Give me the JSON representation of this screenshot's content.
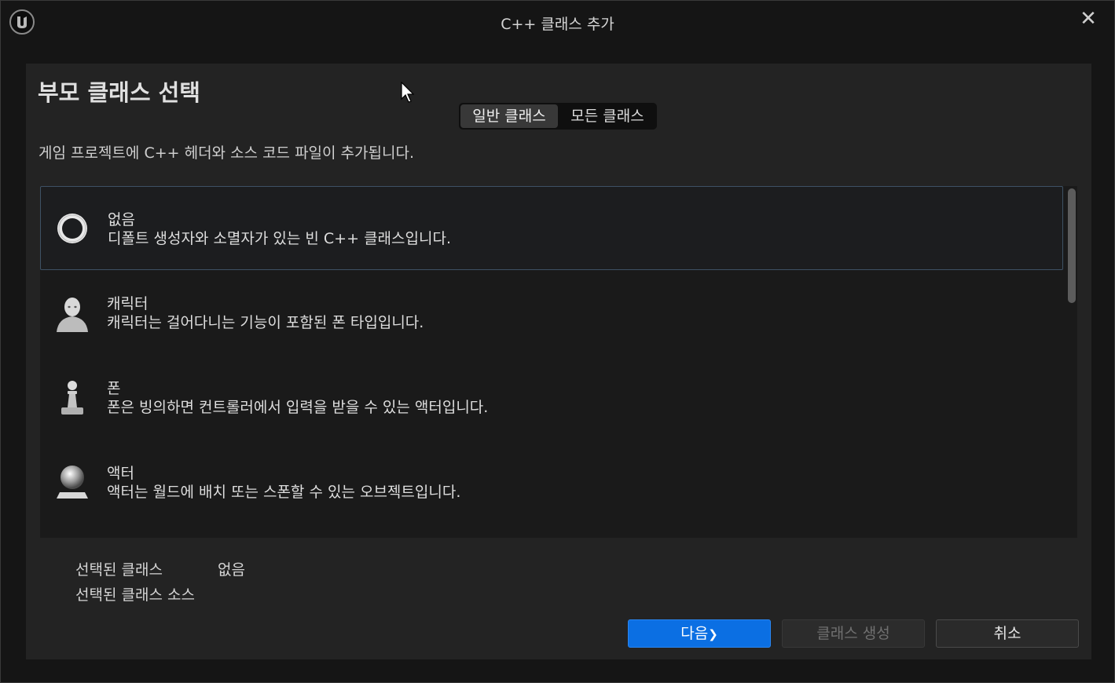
{
  "window": {
    "title": "C++ 클래스 추가",
    "close_glyph": "✕"
  },
  "header": {
    "title": "부모 클래스 선택",
    "description": "게임 프로젝트에 C++ 헤더와 소스 코드 파일이 추가됩니다."
  },
  "tabs": [
    {
      "label": "일반 클래스",
      "active": true
    },
    {
      "label": "모든 클래스",
      "active": false
    }
  ],
  "class_list": [
    {
      "name": "없음",
      "description": "디폴트 생성자와 소멸자가 있는 빈 C++ 클래스입니다.",
      "icon": "empty-ring-icon",
      "selected": true
    },
    {
      "name": "캐릭터",
      "description": "캐릭터는 걸어다니는 기능이 포함된 폰 타입입니다.",
      "icon": "character-bust-icon",
      "selected": false
    },
    {
      "name": "폰",
      "description": "폰은 빙의하면 컨트롤러에서 입력을 받을 수 있는 액터입니다.",
      "icon": "pawn-piece-icon",
      "selected": false
    },
    {
      "name": "액터",
      "description": "액터는 월드에 배치 또는 스폰할 수 있는 오브젝트입니다.",
      "icon": "actor-sphere-icon",
      "selected": false
    }
  ],
  "selection": {
    "selected_class_label": "선택된 클래스",
    "selected_class_value": "없음",
    "selected_source_label": "선택된 클래스 소스",
    "selected_source_value": ""
  },
  "buttons": {
    "next_label": "다음",
    "next_glyph": "❯",
    "create_label": "클래스 생성",
    "cancel_label": "취소"
  },
  "colors": {
    "accent_blue": "#0b6fe3",
    "panel_bg": "#232323",
    "selected_border": "#3e5164"
  }
}
